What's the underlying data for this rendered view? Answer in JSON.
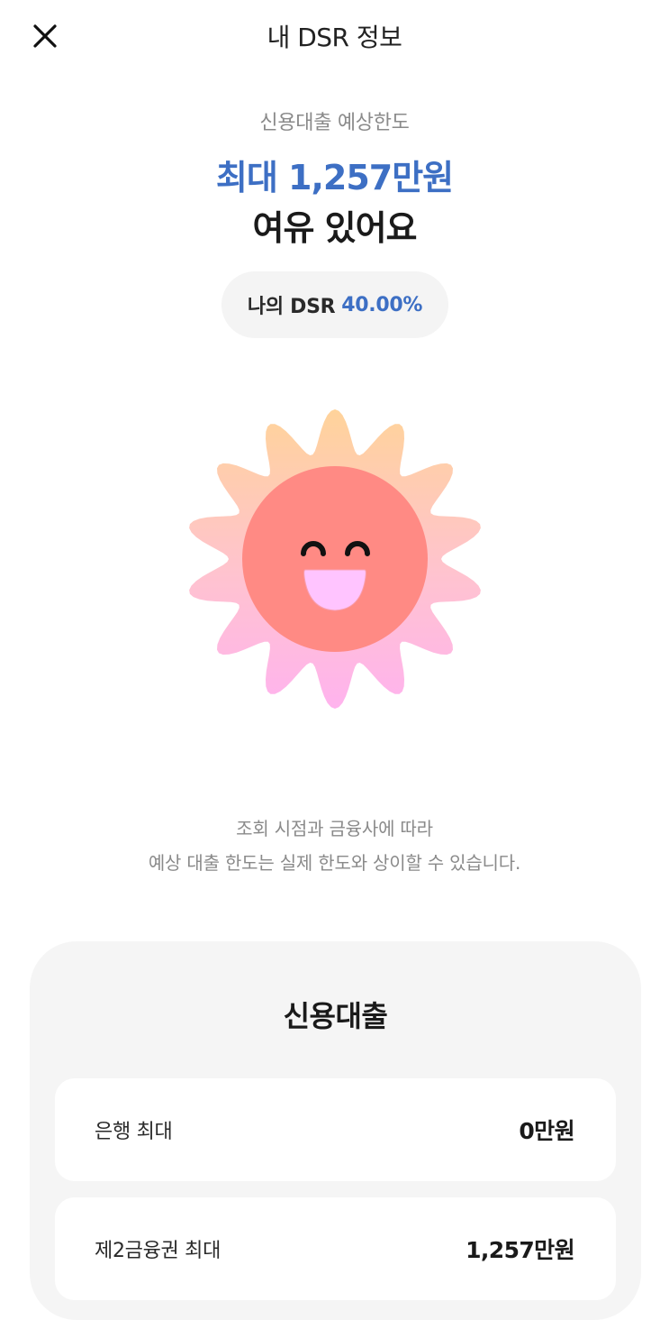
{
  "header": {
    "title": "내 DSR 정보",
    "close_icon": "close-icon"
  },
  "summary": {
    "subtitle": "신용대출 예상한도",
    "limit": "최대 1,257만원",
    "status": "여유 있어요",
    "dsr_label": "나의 DSR",
    "dsr_value": "40.00%"
  },
  "illustration": {
    "icon": "smiling-sun-icon"
  },
  "notice": {
    "line1": "조회 시점과 금융사에 따라",
    "line2": "예상 대출 한도는 실제 한도와 상이할 수 있습니다."
  },
  "credit_loan": {
    "title": "신용대출",
    "rows": [
      {
        "label": "은행 최대",
        "value": "0만원"
      },
      {
        "label": "제2금융권 최대",
        "value": "1,257만원"
      }
    ]
  },
  "colors": {
    "accent": "#3d6fc4",
    "sun_face": "#ff8a84",
    "sun_petal_top": "#ffd39a",
    "sun_petal_bottom": "#ffb3ee",
    "card_bg": "#f5f5f5"
  }
}
